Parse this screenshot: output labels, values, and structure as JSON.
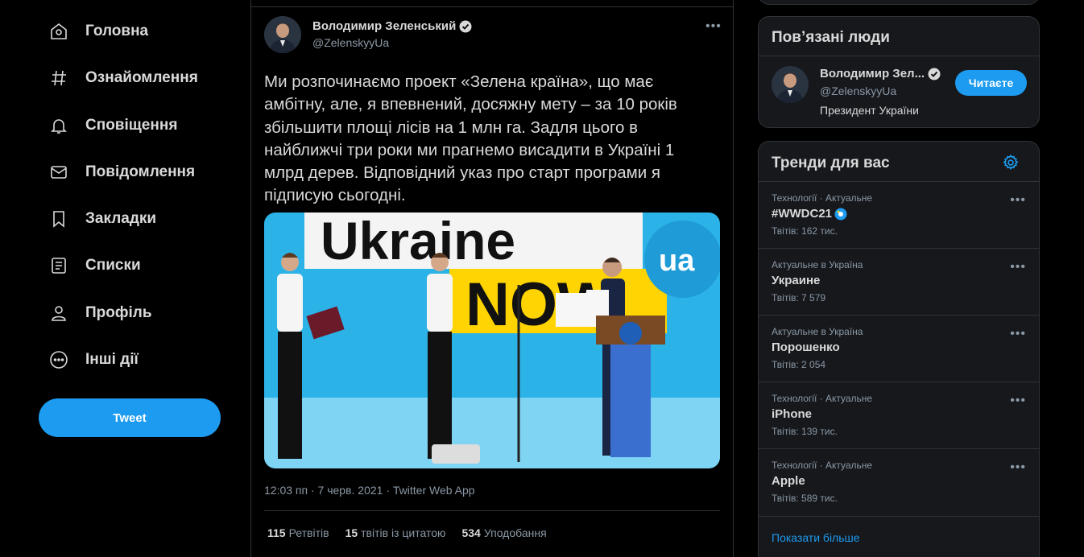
{
  "nav": {
    "items": [
      {
        "label": "Головна",
        "icon": "home-icon"
      },
      {
        "label": "Ознайомлення",
        "icon": "hashtag-icon"
      },
      {
        "label": "Сповіщення",
        "icon": "bell-icon"
      },
      {
        "label": "Повідомлення",
        "icon": "envelope-icon"
      },
      {
        "label": "Закладки",
        "icon": "bookmark-icon"
      },
      {
        "label": "Списки",
        "icon": "list-icon"
      },
      {
        "label": "Профіль",
        "icon": "person-icon"
      },
      {
        "label": "Інші дії",
        "icon": "more-circle-icon"
      }
    ],
    "tweet_button": "Tweet"
  },
  "tweet": {
    "author_name": "Володимир Зеленський",
    "author_handle": "@ZelenskyyUa",
    "text": "Ми розпочинаємо проект «Зелена країна», що має амбітну, але, я впевнений, досяжну мету – за 10 років збільшити площі лісів на 1 млн га. Задля цього в найближчі три роки ми прагнемо висадити в Україні 1 млрд дерев. Відповідний указ про старт програми я підписую сьогодні.",
    "media": {
      "banner_word": "Ukraine",
      "banner_word2": "NOW",
      "badge": "ua"
    },
    "timestamp": "12:03 пп · 7 черв. 2021 · Twitter Web App",
    "stats": {
      "retweets_count": "115",
      "retweets_label": "Ретвітів",
      "quotes_count": "15",
      "quotes_label": "твітів із цитатою",
      "likes_count": "534",
      "likes_label": "Уподобання"
    }
  },
  "related": {
    "title": "Пов’язані люди",
    "person": {
      "name": "Володимир Зел...",
      "handle": "@ZelenskyyUa",
      "bio": "Президент України",
      "follow_label": "Читаєте"
    }
  },
  "trends": {
    "title": "Тренди для вас",
    "items": [
      {
        "context": "Технології · Актуальне",
        "name": "#WWDC21",
        "count": "Твітів: 162 тис."
      },
      {
        "context": "Актуальне в Україна",
        "name": "Украине",
        "count": "Твітів: 7 579"
      },
      {
        "context": "Актуальне в Україна",
        "name": "Порошенко",
        "count": "Твітів: 2 054"
      },
      {
        "context": "Технології · Актуальне",
        "name": "iPhone",
        "count": "Твітів: 139 тис."
      },
      {
        "context": "Технології · Актуальне",
        "name": "Apple",
        "count": "Твітів: 589 тис."
      }
    ],
    "show_more": "Показати більше"
  },
  "colors": {
    "accent": "#1d9bf0",
    "background": "#000000",
    "card": "#16181c",
    "border": "#2f3336"
  }
}
